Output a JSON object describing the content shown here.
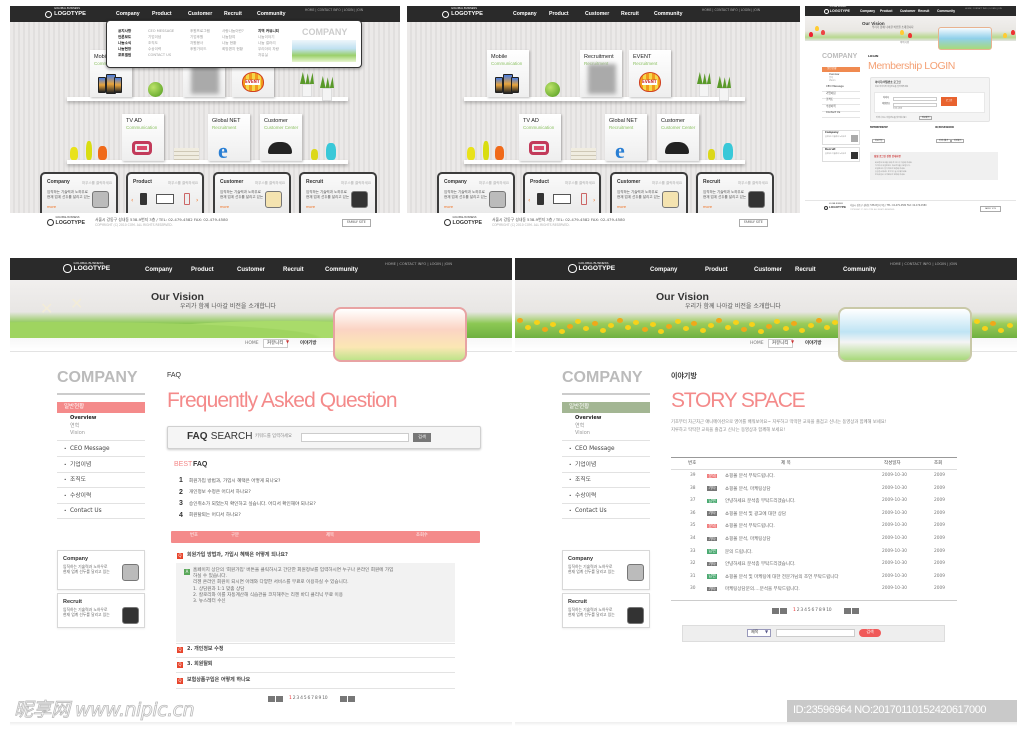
{
  "header": {
    "logo_tagline": "GOLOBAL BUSINESS",
    "logo": "LOGOTYPE",
    "nav": [
      "Company",
      "Product",
      "Customer",
      "Recruit",
      "Community"
    ],
    "links": "HOME  |  CONTACT INFO  |  LOGIN  |  JOIN"
  },
  "dropdown": {
    "columns": [
      [
        "공지사항",
        "언론보도",
        "나눔소식",
        "나눔현장",
        "포토앨범"
      ],
      [
        "CEO MESSAGE",
        "기업이념",
        "조직도",
        "수상이력",
        "CONTACT US"
      ],
      [
        "후원프로그램",
        "기업후원",
        "자원봉사",
        "후원가이드"
      ],
      [
        "사랑나눔이란?",
        "나눔참여",
        "나눔 현황",
        "희망편지 현황"
      ],
      [
        "지역 커뮤니티",
        "나눔이야기",
        "나눔 갤러리",
        "우리아이 자랑",
        "자유실"
      ]
    ],
    "banner": "COMPANY"
  },
  "shelf_cards": [
    {
      "title": "Mobile",
      "sub": "Communication",
      "icon": "mobile-phones-icon"
    },
    {
      "title": "Recruitment",
      "sub": "Recruitment",
      "icon": "people-icon"
    },
    {
      "title": "EVENT",
      "sub": "Recruitment",
      "icon": "hot-air-balloon-icon"
    },
    {
      "title": "TV AD",
      "sub": "Communication",
      "icon": "tv-icon"
    },
    {
      "title": "Global NET",
      "sub": "Recruitment",
      "icon": "internet-explorer-icon"
    },
    {
      "title": "Customer",
      "sub": "Customer Center",
      "icon": "telephone-icon"
    }
  ],
  "bottom_boxes": [
    {
      "title": "Company",
      "hint": "마우스를 클릭하세요",
      "desc1": "임직하는 기술력과 노하우로",
      "desc2": "현재 업계 선두를 달리고 있는",
      "more": "more"
    },
    {
      "title": "Product",
      "hint": "마우스를 클릭하세요",
      "desc1": "",
      "desc2": "",
      "more": ""
    },
    {
      "title": "Customer",
      "hint": "마우스를 클릭하세요",
      "desc1": "임직하는 기술력과 노하우로",
      "desc2": "현재 업계 선두를 달리고 있는",
      "more": "more"
    },
    {
      "title": "Recruit",
      "hint": "마우스를 클릭하세요",
      "desc1": "임직하는 기술력과 노하우로",
      "desc2": "현재 업계 선두를 달리고 있는",
      "more": "more"
    }
  ],
  "footer": {
    "address": "서울시 강동구 성내동 538-9번지 3층 / TEL: 02-479-4582  FAX: 02-479-4580",
    "copyright": "COPYRIGHT (C) 2010 COM. ALL RIGHTS RESERVED.",
    "family_site": "FAMILY SITE"
  },
  "sub_page": {
    "vision_title": "Our Vision",
    "vision_sub": "우리가 함께 나아갈 비전을 소개합니다",
    "breadcrumb_home": "HOME",
    "breadcrumb_select": "커뮤니티",
    "breadcrumb_current": "이야기방",
    "company_title": "COMPANY",
    "menu_active": "일반현황",
    "submenu": [
      "Overview",
      "연혁",
      "Vision"
    ],
    "menu": [
      "CEO Message",
      "기업이념",
      "조직도",
      "수상이력",
      "Contact Us"
    ],
    "side_boxes": [
      {
        "title": "Company",
        "desc1": "임직하는 기술력과 노하우로",
        "desc2": "현재 업계 선두를 달리고 있는"
      },
      {
        "title": "Recruit",
        "desc1": "임직하는 기술력과 노하우로",
        "desc2": "현재 업계 선두를 달리고 있는"
      }
    ]
  },
  "login": {
    "label": "LOGIN",
    "title": "Membership LOGIN",
    "box_title": "아이디/비밀번호 로그인",
    "box_desc": "회원 아이디와 비밀번호를 입력해주세요",
    "id_label": "아이디",
    "pw_label": "비밀번호",
    "button": "로그인",
    "save_id": "아이디저장",
    "find_text": "아이디 또는 비밀번호를 잊으셨나요?",
    "find_button": "정보찾기",
    "membership": "MEMBERSHIP",
    "idpw": "ID/PASSWORD",
    "join_button": "회원가입",
    "find_id_button": "아이디찾기",
    "find_pw_button": "비번찾기",
    "notice_title": "회원 로그인 관련 안내사항",
    "notice_lines": [
      "회원정보 보호를 위해 로그인 후 이용해 주세요.",
      "아이디와 비밀번호는 대소문자를 구분합니다.",
      "비밀번호는 정기적으로 변경해 주세요.",
      "공공장소에서는 로그아웃을 꼭 해주세요.",
      "문의사항은 고객센터로 연락해 주세요."
    ]
  },
  "faq": {
    "label": "FAQ",
    "title": "Frequently Asked Question",
    "search_bold": "FAQ",
    "search_rest": " SEARCH",
    "search_hint": "키워드를 입력하세요",
    "search_button": "검색",
    "best_accent": "BEST",
    "best_rest": " FAQ",
    "best": [
      {
        "n": "1",
        "q": "회원가입 방법과, 가입시 혜택은 어떻게 되나요?"
      },
      {
        "n": "2",
        "q": "개인정보 수정은 어디서 하나요?"
      },
      {
        "n": "3",
        "q": "승인취소가 되었는지 확인하고 싶습니다. 어디서 확인해야 되나요?"
      },
      {
        "n": "4",
        "q": "회원탈퇴는 어디서 하나요?"
      }
    ],
    "columns": [
      "번호",
      "구분",
      "제목",
      "조회수"
    ],
    "questions": [
      "회원가입 방법과, 가입시 혜택은 어떻게 되나요?",
      "2. 개인정보 수정",
      "3. 회원탈퇴",
      "보험상품구입은 어떻게 하나요"
    ],
    "answer": [
      "홈페이지 상단의 '회원가입' 버튼을 클릭하시고 간단한 회원정보를 입력하시면 누구나 온라인 회원에 가입",
      "하실 수 있습니다.",
      "리젠 온라인 회원이 되시면 아래와 다양한 서비스를 무료로 이용하실 수 있습니다.",
      "1. 상담원과 1:1 맞춤 상담",
      "2. 칼로리와 이를 자동계산해 식습관을 코치해주는 리젠 바디 클리닉 무료 이용",
      "3. 뉴스레터 수신"
    ],
    "pages": "1 2 3 4 5 6 7 8 9 10",
    "current_page": "1"
  },
  "story": {
    "label": "이야기방",
    "title": "STORY SPACE",
    "desc1": "기초부터 차근차근 애니메이션으로 영어를 배워보아요~ 지루하고 딱딱한 교육을 즐겁고 신나는 동영상과 함께해 보세요!",
    "desc2": "지루하고 딱딱한 교육을 즐겁고 신나는 동영상과 함께해 보세요!",
    "columns": [
      "번호",
      "제 목",
      "작성일자",
      "조회"
    ],
    "rows": [
      {
        "no": "39",
        "tag": "문의",
        "tag_color": "#f07f7f",
        "title": "쇼핑몰 분석 부탁드립니다.",
        "date": "2009-10-30",
        "views": "2009"
      },
      {
        "no": "38",
        "tag": "기타",
        "tag_color": "#777777",
        "title": "쇼핑몰 분석, 마케팅상담",
        "date": "2009-10-30",
        "views": "2009"
      },
      {
        "no": "37",
        "tag": "답변",
        "tag_color": "#4caa72",
        "title": "안녕하세요 분석좀 부탁드리겠습니다.",
        "date": "2009-10-30",
        "views": "2009"
      },
      {
        "no": "36",
        "tag": "기타",
        "tag_color": "#777777",
        "title": "쇼핑몰 분석 및 광고에 대한 상담",
        "date": "2009-10-30",
        "views": "2009"
      },
      {
        "no": "35",
        "tag": "문의",
        "tag_color": "#f07f7f",
        "title": "쇼핑몰 분석 부탁드립니다.",
        "date": "2009-10-30",
        "views": "2009"
      },
      {
        "no": "34",
        "tag": "기타",
        "tag_color": "#777777",
        "title": "쇼핑몰 분석, 마케팅상담",
        "date": "2009-10-30",
        "views": "2009"
      },
      {
        "no": "33",
        "tag": "답변",
        "tag_color": "#4caa72",
        "title": "문의 드립니다.",
        "date": "2009-10-30",
        "views": "2009"
      },
      {
        "no": "32",
        "tag": "기타",
        "tag_color": "#777777",
        "title": "안녕하세요 분석좀 부탁드리겠습니다.",
        "date": "2009-10-30",
        "views": "2009"
      },
      {
        "no": "31",
        "tag": "답변",
        "tag_color": "#4caa72",
        "title": "쇼핑몰 분석 및 마케팅에 대한 전문가님의 조언 부탁드립니다",
        "date": "2009-10-30",
        "views": "2009"
      },
      {
        "no": "30",
        "tag": "기타",
        "tag_color": "#777777",
        "title": "마케팅상담문의....분석을 부탁드립니다.",
        "date": "2009-10-30",
        "views": "2009"
      }
    ],
    "pages": "1 2 3 4 5 6 7 8 9 10",
    "current_page": "1",
    "search_select": "제목",
    "search_button": "검색"
  },
  "watermark": {
    "text": "昵享网 www.nipic.cn",
    "id": "ID:23596964 NO:20170110152420617000"
  },
  "colors": {
    "faq_accent": "#f48a8a",
    "story_accent": "#a3b693",
    "login_accent": "#f08a50",
    "header": "#2a2a2a"
  }
}
